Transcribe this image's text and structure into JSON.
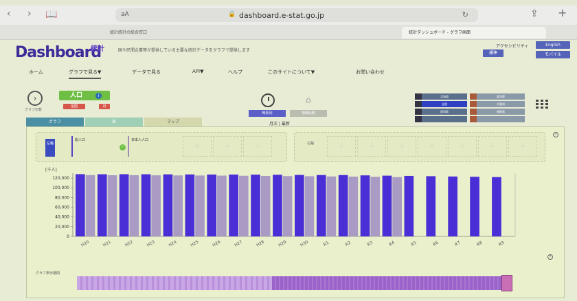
{
  "browser": {
    "status_text": "",
    "address_prefix": "aA",
    "url": "dashboard.e-stat.go.jp",
    "lock_icon": "lock-icon",
    "tabs": [
      {
        "label": "総計統計の総合窓口"
      },
      {
        "label": "統計ダッシュボード - グラフ画面"
      }
    ]
  },
  "header": {
    "logo_main": "Dashboard",
    "logo_jp": "統計",
    "tagline": "国や民間企業等が提供している主要な統計データをグラフで提供します",
    "accessibility_label": "アクセシビリティ",
    "btn_english": "English",
    "btn_mobile": "モバイル",
    "btn_size": "標準",
    "btn_print": "印刷"
  },
  "menu": {
    "items": [
      {
        "label": "ホーム"
      },
      {
        "label": "グラフで見る▼"
      },
      {
        "label": "データで見る"
      },
      {
        "label": "API▼"
      },
      {
        "label": "ヘルプ"
      },
      {
        "label": "このサイトについて▼"
      },
      {
        "label": "お問い合わせ"
      }
    ]
  },
  "controls": {
    "chart_change_label": "グラフ切替",
    "indicator_label": "人口",
    "region_btn": "全国",
    "period_btn": "月",
    "mode_a": "時系列",
    "mode_b": "地域比較",
    "period_label": "月次 | 最新"
  },
  "regions": {
    "cells": [
      "全国",
      "北海道",
      "東京都",
      "大阪府",
      "愛知県",
      "福岡県"
    ]
  },
  "view_tabs": [
    "グラフ",
    "表",
    "マップ"
  ],
  "series_select": {
    "left_axis_label": "左軸",
    "right_axis_label": "右軸",
    "series1": "総人口",
    "series2": "日本人人口"
  },
  "chart": {
    "unit_label": "[千人]",
    "slider_label": "グラフ表示期間"
  },
  "chart_data": {
    "type": "bar",
    "ylabel": "[千人]",
    "ylim": [
      0,
      130000
    ],
    "yticks": [
      "0",
      "20,000",
      "40,000",
      "60,000",
      "80,000",
      "100,000",
      "120,000"
    ],
    "categories": [
      "H20",
      "H21",
      "H22",
      "H23",
      "H24",
      "H25",
      "H26",
      "H27",
      "H28",
      "H29",
      "H30",
      "R1",
      "R2",
      "R3",
      "R4",
      "R5",
      "R6",
      "R7",
      "R8",
      "R9"
    ],
    "series": [
      {
        "name": "総人口",
        "color": "#4b2fd6",
        "values": [
          128000,
          127800,
          127900,
          127800,
          127600,
          127400,
          127200,
          127100,
          127000,
          126700,
          126400,
          126200,
          126100,
          125500,
          124900,
          124400,
          123800,
          123200,
          122600,
          122000
        ]
      },
      {
        "name": "日本人人口",
        "color": "#a99bc4",
        "values": [
          126000,
          125800,
          125900,
          125600,
          125400,
          125200,
          125000,
          124700,
          124300,
          124000,
          123700,
          123300,
          123000,
          122500,
          121900,
          null,
          null,
          null,
          null,
          null
        ]
      }
    ]
  }
}
